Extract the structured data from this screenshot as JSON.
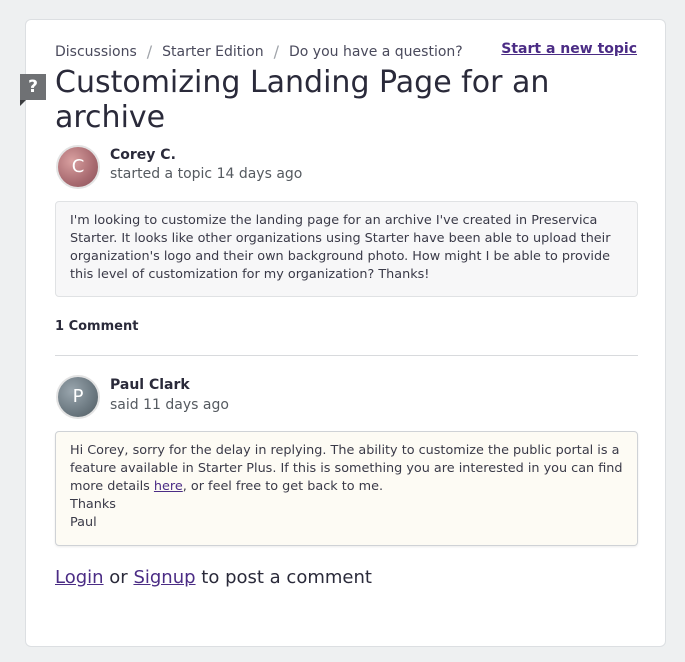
{
  "breadcrumb": {
    "items": [
      "Discussions",
      "Starter Edition",
      "Do you have a question?"
    ],
    "separator": "/"
  },
  "actions": {
    "start_topic": "Start a new topic"
  },
  "badge": {
    "symbol": "?"
  },
  "topic": {
    "title": "Customizing Landing Page for an archive",
    "author": {
      "initial": "C",
      "name": "Corey C.",
      "meta": "started a topic 14 days ago"
    },
    "body": "I'm looking to customize the landing page for an archive I've created in Preservica Starter.  It looks like other organizations using Starter have been able to upload their organization's logo and their own background photo.  How might I be able to provide this level of customization for my organization?  Thanks!"
  },
  "comments": {
    "heading": "1 Comment",
    "items": [
      {
        "initial": "P",
        "name": "Paul Clark",
        "meta": "said 11 days ago",
        "body_before_link": "Hi Corey, sorry for the delay in replying. The ability to customize the public portal is a feature available in Starter Plus. If this is something you are interested in you can find more details ",
        "link_text": "here",
        "body_after_link": ", or feel free to get back to me.",
        "signoff_1": "Thanks",
        "signoff_2": "Paul"
      }
    ]
  },
  "footer": {
    "login": "Login",
    "or": "or",
    "signup": "Signup",
    "suffix": "to post a comment"
  },
  "colors": {
    "accent": "#4b2c85",
    "background": "#eef0f1",
    "reply_bg": "#fdfbf4",
    "post_bg": "#f7f7f8"
  }
}
